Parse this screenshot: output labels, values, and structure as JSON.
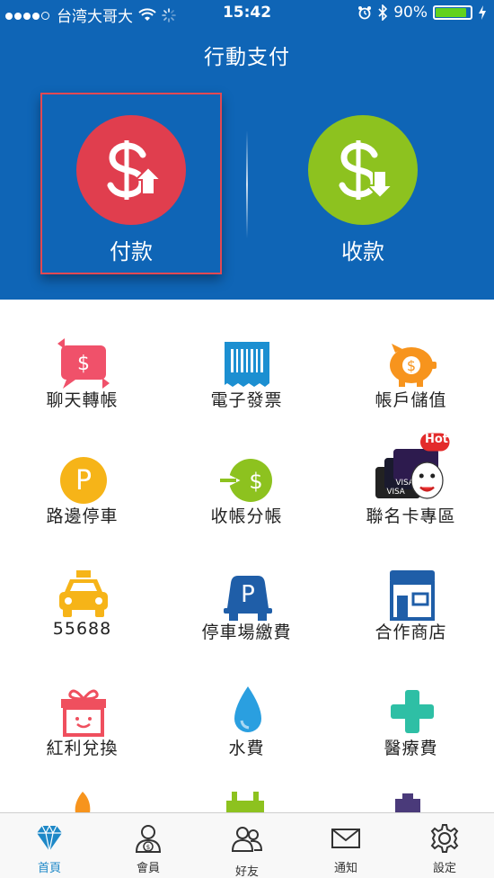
{
  "status_bar": {
    "carrier": "台湾大哥大",
    "time": "15:42",
    "battery_pct": "90%",
    "battery_level": 0.9
  },
  "header": {
    "title": "行動支付"
  },
  "actions": {
    "pay_label": "付款",
    "receive_label": "收款"
  },
  "grid": {
    "items": [
      {
        "label": "聊天轉帳",
        "icon": "chat-transfer-icon"
      },
      {
        "label": "電子發票",
        "icon": "e-invoice-icon"
      },
      {
        "label": "帳戶儲值",
        "icon": "piggy-bank-icon"
      },
      {
        "label": "路邊停車",
        "icon": "parking-p-icon"
      },
      {
        "label": "收帳分帳",
        "icon": "split-bill-icon"
      },
      {
        "label": "聯名卡專區",
        "icon": "co-brand-card-icon",
        "badge": "Hot"
      },
      {
        "label": "55688",
        "icon": "taxi-icon"
      },
      {
        "label": "停車場繳費",
        "icon": "parking-lot-icon"
      },
      {
        "label": "合作商店",
        "icon": "store-icon"
      },
      {
        "label": "紅利兌換",
        "icon": "gift-icon"
      },
      {
        "label": "水費",
        "icon": "water-drop-icon"
      },
      {
        "label": "醫療費",
        "icon": "medical-cross-icon"
      }
    ]
  },
  "tabbar": {
    "tabs": [
      {
        "label": "首頁",
        "icon": "diamond-icon",
        "active": true
      },
      {
        "label": "會員",
        "icon": "member-icon"
      },
      {
        "label": "好友",
        "icon": "friends-icon"
      },
      {
        "label": "通知",
        "icon": "mail-icon"
      },
      {
        "label": "設定",
        "icon": "gear-icon"
      }
    ]
  },
  "colors": {
    "header_blue": "#0f65b6",
    "pay_red": "#e03e4e",
    "receive_green": "#8dc21f",
    "active_tab": "#1e88c7"
  }
}
